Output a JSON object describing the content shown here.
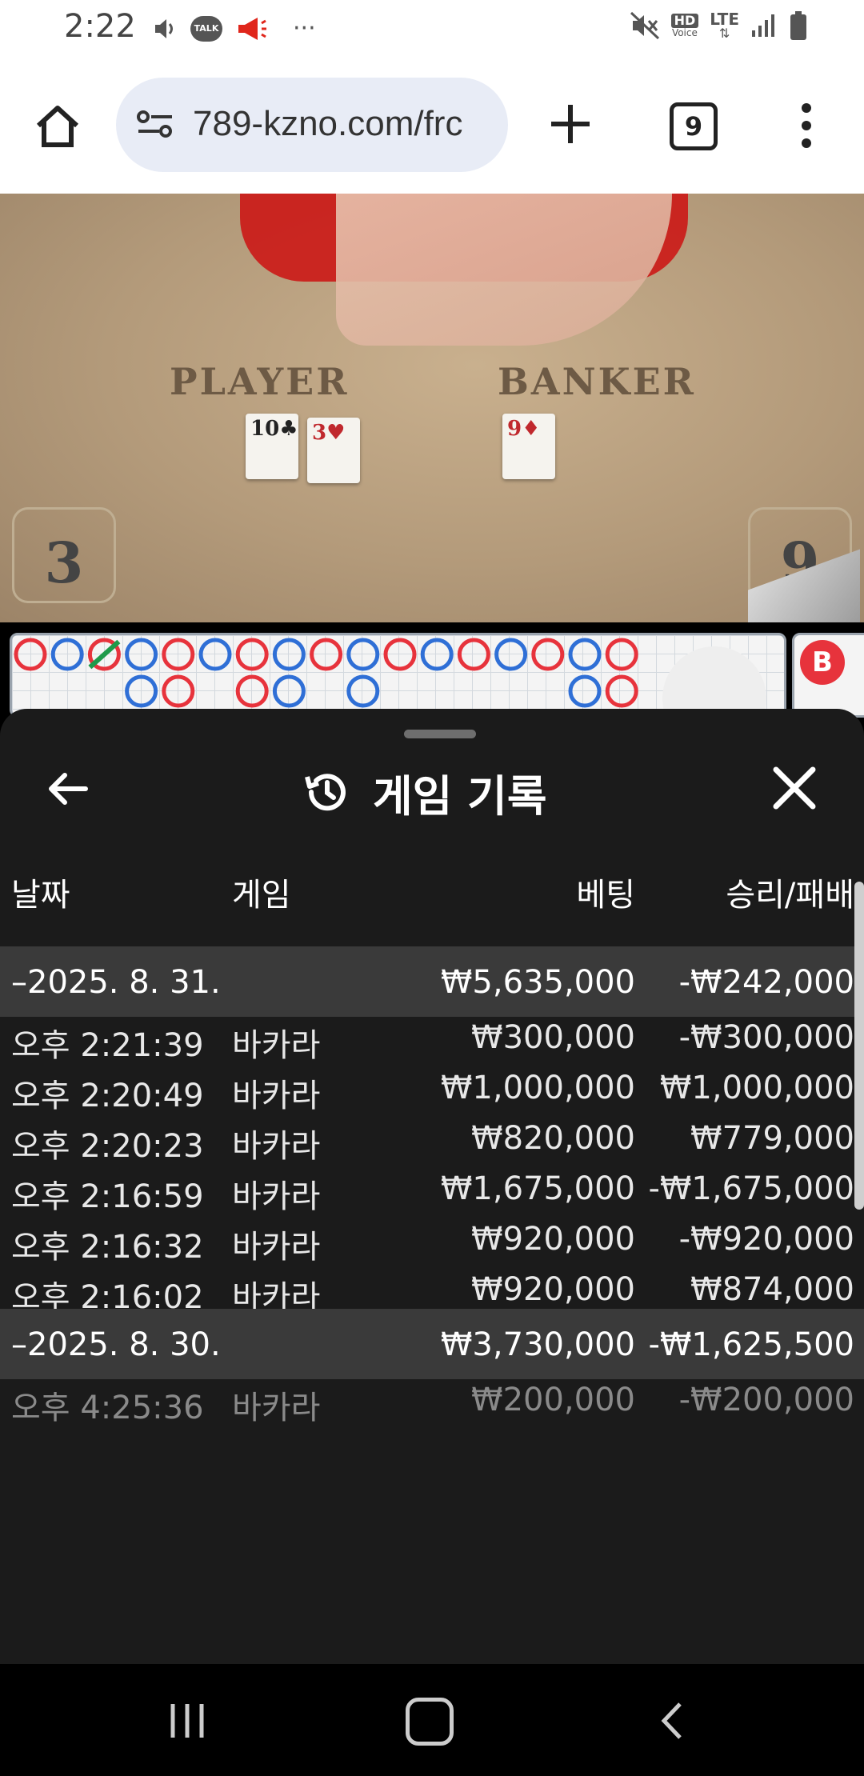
{
  "status_bar": {
    "time": "2:22",
    "talk_icon_text": "TALK",
    "overflow": "···",
    "hd_voice_top": "HD",
    "hd_voice_bottom": "Voice",
    "network": "LTE"
  },
  "browser": {
    "url": "789-kzno.com/frc",
    "tab_count": "9"
  },
  "video": {
    "player_label": "PLAYER",
    "banker_label": "BANKER",
    "player_score": "3",
    "banker_score": "9",
    "player_cards": [
      {
        "rank": "10",
        "suit": "♣",
        "color": "black"
      },
      {
        "rank": "3",
        "suit": "♥",
        "color": "red"
      }
    ],
    "banker_cards": [
      {
        "rank": "9",
        "suit": "♦",
        "color": "red"
      }
    ]
  },
  "road_map": {
    "colors": {
      "banker": "#e7333c",
      "player": "#2f6fd6",
      "tie": "#1f9a4a"
    },
    "row1": [
      "B",
      "P",
      "T",
      "P",
      "B",
      "P",
      "B",
      "P",
      "B",
      "P",
      "B",
      "P",
      "B",
      "P",
      "B",
      "P",
      "B"
    ],
    "row2": [
      "",
      "",
      "",
      "P",
      "B",
      "",
      "B",
      "P",
      "",
      "P",
      "",
      "",
      "",
      "",
      "",
      "P",
      "B"
    ],
    "side_badge": "B"
  },
  "sheet": {
    "title": "게임 기록",
    "headers": {
      "date": "날짜",
      "game": "게임",
      "bet": "베팅",
      "win_loss": "승리/패배"
    },
    "rows": [
      {
        "type": "group",
        "date": "–2025. 8. 31.",
        "game": "",
        "bet": "₩5,635,000",
        "win_loss": "-₩242,000"
      },
      {
        "type": "item",
        "date": "오후 2:21:39",
        "game": "바카라",
        "bet": "₩300,000",
        "win_loss": "-₩300,000"
      },
      {
        "type": "item",
        "date": "오후 2:20:49",
        "game": "바카라",
        "bet": "₩1,000,000",
        "win_loss": "₩1,000,000"
      },
      {
        "type": "item",
        "date": "오후 2:20:23",
        "game": "바카라",
        "bet": "₩820,000",
        "win_loss": "₩779,000"
      },
      {
        "type": "item",
        "date": "오후 2:16:59",
        "game": "바카라",
        "bet": "₩1,675,000",
        "win_loss": "-₩1,675,000"
      },
      {
        "type": "item",
        "date": "오후 2:16:32",
        "game": "바카라",
        "bet": "₩920,000",
        "win_loss": "-₩920,000"
      },
      {
        "type": "item",
        "date": "오후 2:16:02",
        "game": "바카라",
        "bet": "₩920,000",
        "win_loss": "₩874,000"
      },
      {
        "type": "group",
        "date": "–2025. 8. 30.",
        "game": "",
        "bet": "₩3,730,000",
        "win_loss": "-₩1,625,500"
      },
      {
        "type": "faded",
        "date": "오후 4:25:36",
        "game": "바카라",
        "bet": "₩200,000",
        "win_loss": "-₩200,000"
      }
    ]
  }
}
